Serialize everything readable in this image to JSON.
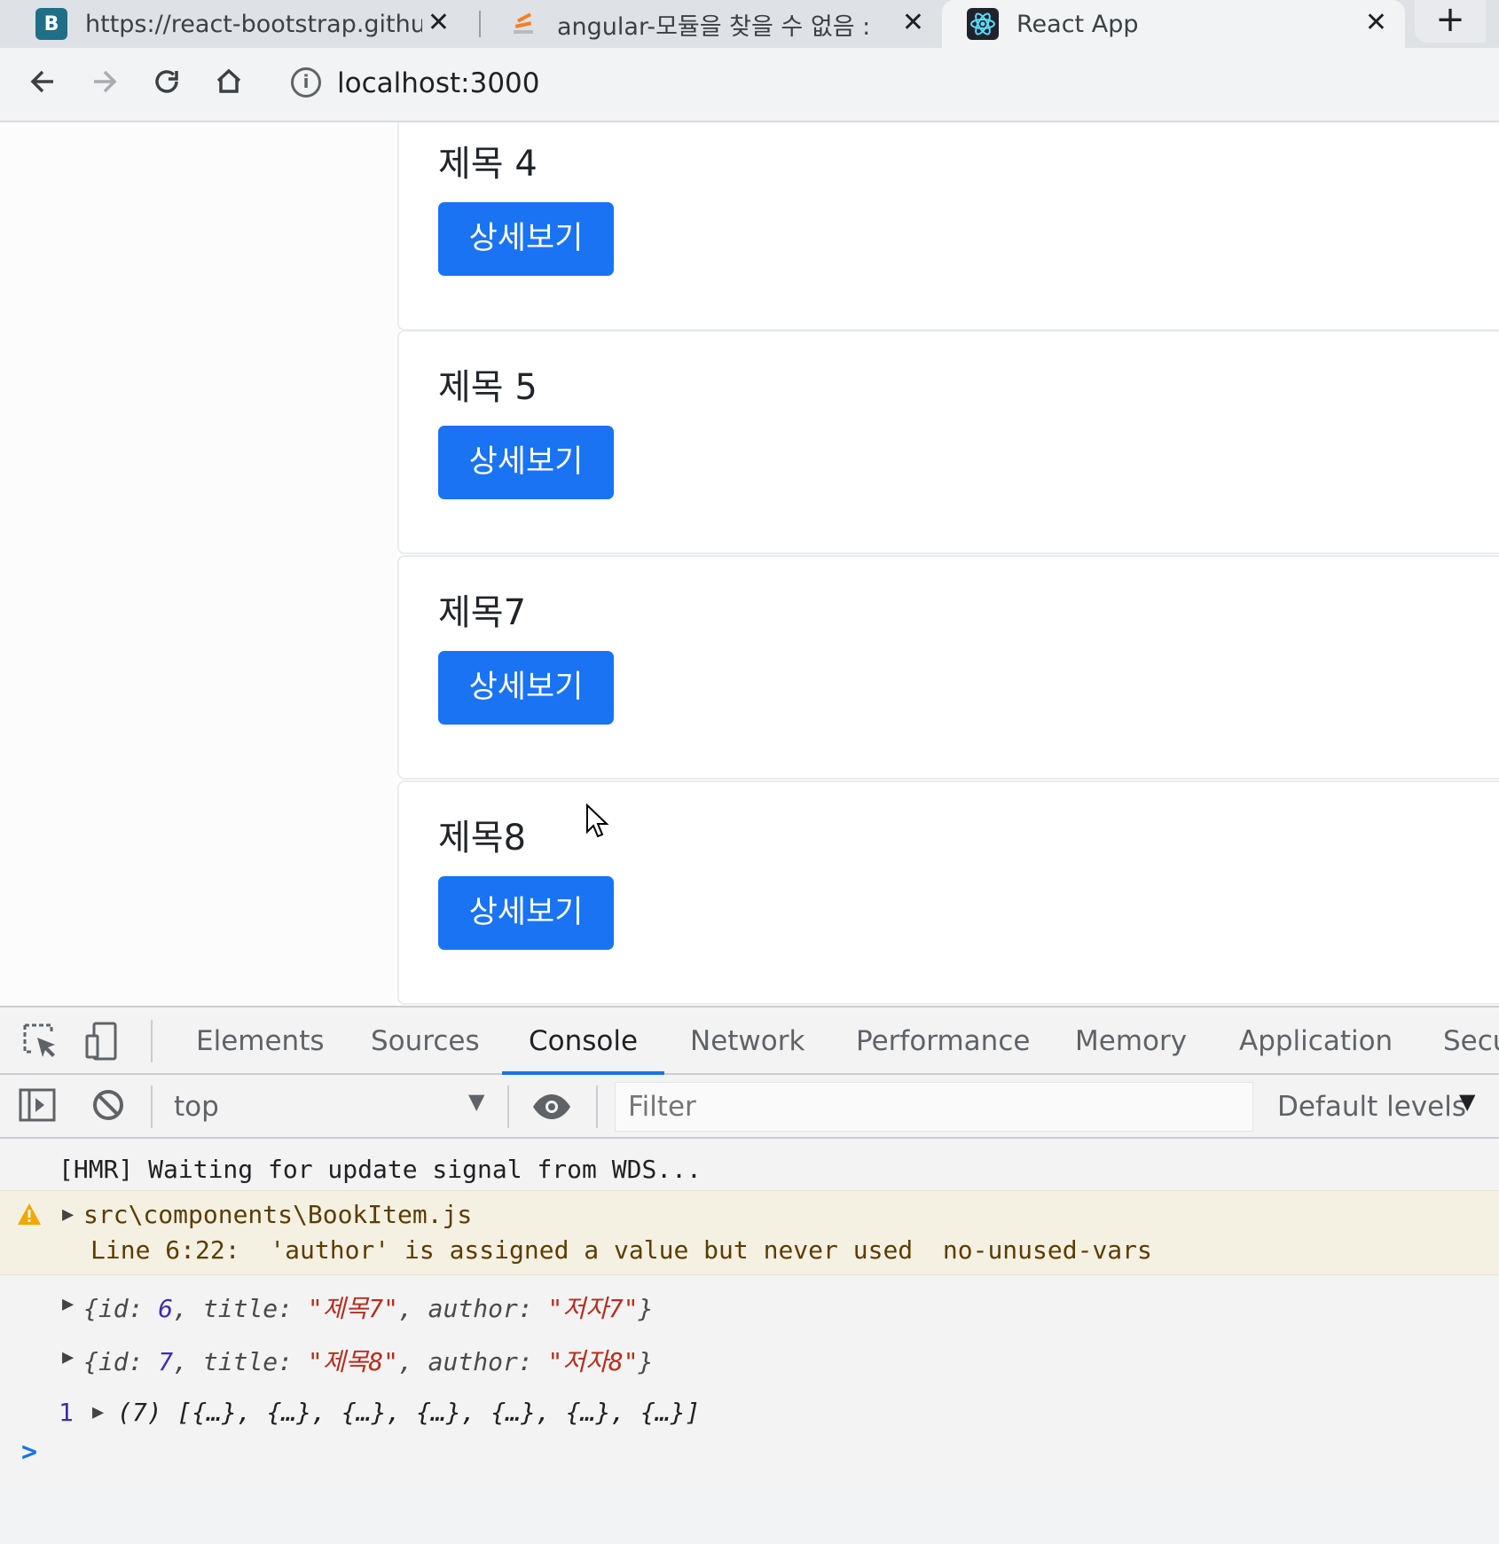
{
  "browser": {
    "tabs": [
      {
        "title": "https://react-bootstrap.github.io",
        "favicon": "bootstrap-icon",
        "active": false
      },
      {
        "title": "angular-모듈을 찾을 수 없음 : 오",
        "favicon": "stackoverflow-icon",
        "active": false
      },
      {
        "title": "React App",
        "favicon": "react-icon",
        "active": true
      }
    ],
    "new_tab_label": "+",
    "close_label": "✕",
    "url": "localhost:3000"
  },
  "page": {
    "cards": [
      {
        "title": "제목 4",
        "button": "상세보기"
      },
      {
        "title": "제목 5",
        "button": "상세보기"
      },
      {
        "title": "제목7",
        "button": "상세보기"
      },
      {
        "title": "제목8",
        "button": "상세보기"
      }
    ],
    "accent_color": "#1a73f2"
  },
  "devtools": {
    "tabs": [
      "Elements",
      "Sources",
      "Console",
      "Network",
      "Performance",
      "Memory",
      "Application",
      "Secu"
    ],
    "active_tab": "Console",
    "context": "top",
    "filter_placeholder": "Filter",
    "levels": "Default levels",
    "console": {
      "hmr": "[HMR] Waiting for update signal from WDS...",
      "warn_file": "src\\components\\BookItem.js",
      "warn_msg": "Line 6:22:  'author' is assigned a value but never used  no-unused-vars",
      "log1": {
        "id": "6",
        "title": "\"제목7\"",
        "author": "\"저자7\""
      },
      "log2": {
        "id": "7",
        "title": "\"제목8\"",
        "author": "\"저자8\""
      },
      "array_count_badge": "1",
      "array_summary": "(7) [{…}, {…}, {…}, {…}, {…}, {…}, {…}]",
      "prompt": ">"
    }
  }
}
